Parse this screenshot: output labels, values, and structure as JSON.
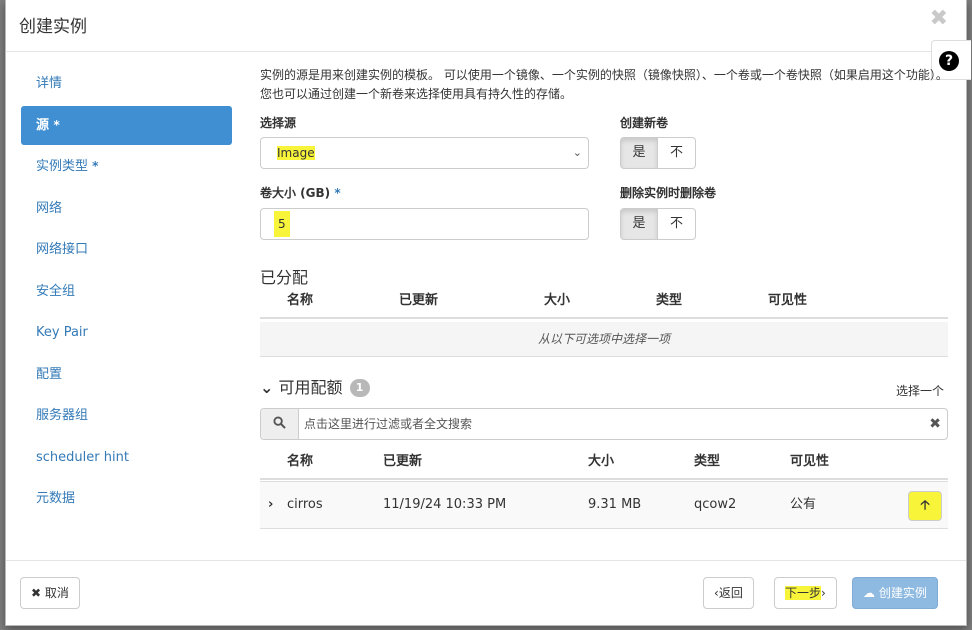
{
  "modal": {
    "title": "创建实例",
    "close": "✖",
    "help": "?"
  },
  "sidebar": {
    "items": [
      {
        "label": "详情",
        "required": ""
      },
      {
        "label": "源",
        "required": "*"
      },
      {
        "label": "实例类型",
        "required": "*"
      },
      {
        "label": "网络",
        "required": ""
      },
      {
        "label": "网络接口",
        "required": ""
      },
      {
        "label": "安全组",
        "required": ""
      },
      {
        "label": "Key Pair",
        "required": ""
      },
      {
        "label": "配置",
        "required": ""
      },
      {
        "label": "服务器组",
        "required": ""
      },
      {
        "label": "scheduler hint",
        "required": ""
      },
      {
        "label": "元数据",
        "required": ""
      }
    ]
  },
  "help_text": "实例的源是用来创建实例的模板。 可以使用一个镜像、一个实例的快照（镜像快照）、一个卷或一个卷快照（如果启用这个功能）。 您也可以通过创建一个新卷来选择使用具有持久性的存储。",
  "form": {
    "source_label": "选择源",
    "source_value": "Image",
    "new_volume_label": "创建新卷",
    "volume_size_label": "卷大小 (GB)",
    "volume_size_required": "*",
    "volume_size_value": "5",
    "delete_volume_label": "删除实例时删除卷",
    "yes": "是",
    "no": "不"
  },
  "allocated": {
    "title": "已分配",
    "columns": [
      "名称",
      "已更新",
      "大小",
      "类型",
      "可见性"
    ],
    "empty": "从以下可选项中选择一项"
  },
  "available": {
    "title": "可用配额",
    "count": "1",
    "select_one": "选择一个",
    "search_placeholder": "点击这里进行过滤或者全文搜索",
    "columns": [
      "名称",
      "已更新",
      "大小",
      "类型",
      "可见性"
    ],
    "rows": [
      {
        "name": "cirros",
        "updated": "11/19/24 10:33 PM",
        "size": "9.31 MB",
        "type": "qcow2",
        "visibility": "公有"
      }
    ]
  },
  "footer": {
    "cancel": "取消",
    "back": "返回",
    "next": "下一步",
    "create": "创建实例"
  }
}
